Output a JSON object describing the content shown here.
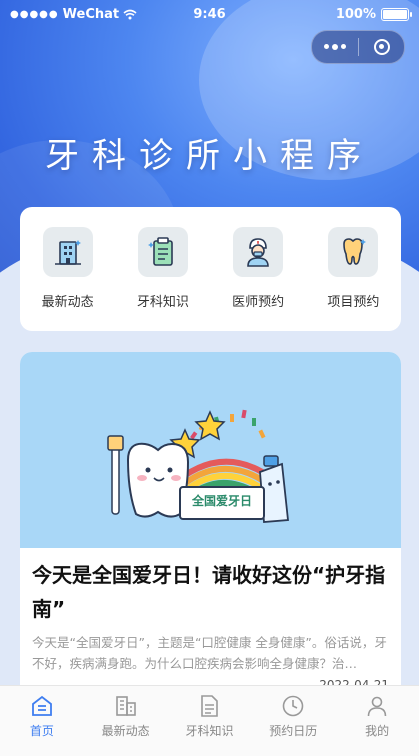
{
  "status_bar": {
    "signal_dots": "●●●●●",
    "carrier": "WeChat",
    "time": "9:46",
    "battery": "100%"
  },
  "capsule": {
    "more_icon": "more-dots-icon",
    "close_icon": "record-circle-icon"
  },
  "page_title": "牙科诊所小程序",
  "menu": [
    {
      "label": "最新动态",
      "icon": "building-icon"
    },
    {
      "label": "牙科知识",
      "icon": "clipboard-icon"
    },
    {
      "label": "医师预约",
      "icon": "doctor-icon"
    },
    {
      "label": "项目预约",
      "icon": "tooth-icon"
    }
  ],
  "article": {
    "banner_sign": "全国爱牙日",
    "headline": "今天是全国爱牙日！请收好这份“护牙指南”",
    "summary": "今天是“全国爱牙日”，主题是“口腔健康 全身健康”。俗话说，牙不好，疾病满身跑。为什么口腔疾病会影响全身健康？治…",
    "date": "2022-04-21"
  },
  "tabs": [
    {
      "label": "首页",
      "icon": "home-icon",
      "active": true
    },
    {
      "label": "最新动态",
      "icon": "news-icon",
      "active": false
    },
    {
      "label": "牙科知识",
      "icon": "document-icon",
      "active": false
    },
    {
      "label": "预约日历",
      "icon": "clock-icon",
      "active": false
    },
    {
      "label": "我的",
      "icon": "user-icon",
      "active": false
    }
  ],
  "colors": {
    "accent": "#3f7ef0",
    "hero": "#4d86f0",
    "banner": "#a9d7f7"
  }
}
